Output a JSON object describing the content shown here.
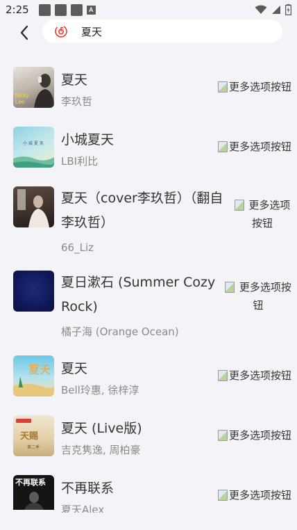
{
  "status": {
    "time": "2:25",
    "notification_icons": [
      "app-icon",
      "app-icon",
      "app-icon",
      "a-badge-icon"
    ],
    "a_badge": "A"
  },
  "search": {
    "query": "夏天"
  },
  "more_button_alt": "更多选项按钮",
  "songs": [
    {
      "title": "夏天",
      "artist": "李玖哲",
      "cover_text": "Nicky Lee"
    },
    {
      "title": "小城夏天",
      "artist": "LBI利比",
      "cover_text": ""
    },
    {
      "title": "夏天（cover李玖哲）（翻自 李玖哲）",
      "artist": "66_Liz",
      "cover_text": ""
    },
    {
      "title": "夏日漱石 (Summer Cozy Rock)",
      "artist": "橘子海 (Orange Ocean)",
      "cover_text": ""
    },
    {
      "title": "夏天",
      "artist": "Bell玲惠, 徐梓淳",
      "cover_text": ""
    },
    {
      "title": "夏天 (Live版)",
      "artist": "吉克隽逸, 周柏豪",
      "cover_text": ""
    },
    {
      "title": "不再联系",
      "artist": "夏天Alex",
      "cover_text": "不再联系"
    }
  ]
}
